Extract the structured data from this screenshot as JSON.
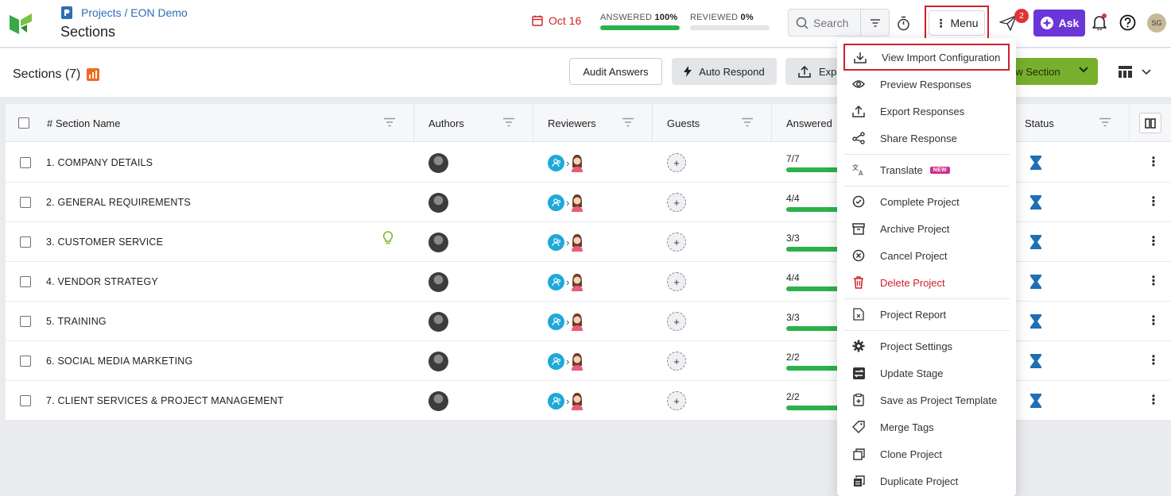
{
  "header": {
    "breadcrumb": "Projects / EON Demo",
    "page_title": "Sections",
    "due_date": "Oct 16",
    "answered_label": "ANSWERED",
    "answered_pct": "100%",
    "answered_value": 1.0,
    "reviewed_label": "REVIEWED",
    "reviewed_pct": "0%",
    "reviewed_value": 0.0,
    "search_placeholder": "Search",
    "menu_label": "Menu",
    "notification_count": "2",
    "ask_label": "Ask",
    "user_initials": "SG"
  },
  "subheader": {
    "title": "Sections (7)",
    "audit_label": "Audit Answers",
    "auto_label": "Auto Respond",
    "export_label": "Exp",
    "new_label": "ew Section"
  },
  "table": {
    "columns": [
      "# Section Name",
      "Authors",
      "Reviewers",
      "Guests",
      "Answered",
      "Status"
    ],
    "rows": [
      {
        "num": "1.",
        "name": "COMPANY DETAILS",
        "answered": "7/7",
        "hint": false
      },
      {
        "num": "2.",
        "name": "GENERAL REQUIREMENTS",
        "answered": "4/4",
        "hint": false
      },
      {
        "num": "3.",
        "name": "CUSTOMER SERVICE",
        "answered": "3/3",
        "hint": true
      },
      {
        "num": "4.",
        "name": "VENDOR STRATEGY",
        "answered": "4/4",
        "hint": false
      },
      {
        "num": "5.",
        "name": "TRAINING",
        "answered": "3/3",
        "hint": false
      },
      {
        "num": "6.",
        "name": "SOCIAL MEDIA MARKETING",
        "answered": "2/2",
        "hint": false
      },
      {
        "num": "7.",
        "name": "CLIENT SERVICES & PROJECT MANAGEMENT",
        "answered": "2/2",
        "hint": false
      }
    ]
  },
  "menu": {
    "items": [
      {
        "label": "View Import Configuration",
        "icon": "download-icon"
      },
      {
        "label": "Preview Responses",
        "icon": "eye-icon"
      },
      {
        "label": "Export Responses",
        "icon": "upload-icon"
      },
      {
        "label": "Share Response",
        "icon": "share-icon"
      },
      {
        "label": "Translate",
        "icon": "translate-icon",
        "tag": "NEW"
      },
      {
        "label": "Complete Project",
        "icon": "check-circle-icon"
      },
      {
        "label": "Archive Project",
        "icon": "archive-icon"
      },
      {
        "label": "Cancel Project",
        "icon": "x-circle-icon"
      },
      {
        "label": "Delete Project",
        "icon": "trash-icon"
      },
      {
        "label": "Project Report",
        "icon": "report-icon"
      },
      {
        "label": "Project Settings",
        "icon": "gear-icon"
      },
      {
        "label": "Update Stage",
        "icon": "stage-icon"
      },
      {
        "label": "Save as Project Template",
        "icon": "template-icon"
      },
      {
        "label": "Merge Tags",
        "icon": "tag-icon"
      },
      {
        "label": "Clone Project",
        "icon": "clone-icon"
      },
      {
        "label": "Duplicate Project",
        "icon": "duplicate-icon"
      }
    ]
  },
  "colors": {
    "accent_red": "#d0202a",
    "progress_green": "#2bb24c",
    "ask_purple": "#6b36d8",
    "new_section_green": "#77b02c",
    "status_blue": "#1f6fb5"
  }
}
